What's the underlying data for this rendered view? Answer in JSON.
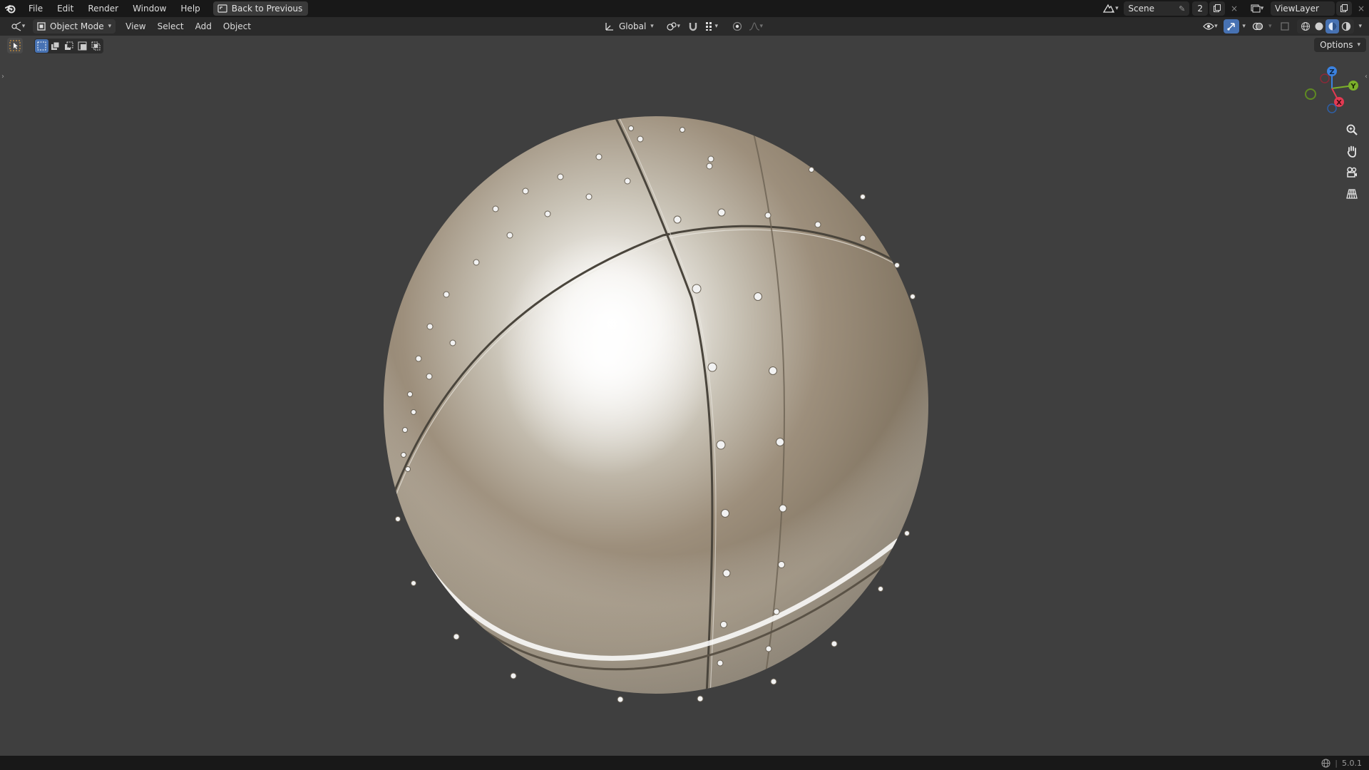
{
  "topbar": {
    "menu": [
      "File",
      "Edit",
      "Render",
      "Window",
      "Help"
    ],
    "back_button": "Back to Previous",
    "scene_name": "Scene",
    "scene_users": "2",
    "view_layer": "ViewLayer"
  },
  "viewport_header": {
    "mode": "Object Mode",
    "menus": [
      "View",
      "Select",
      "Add",
      "Object"
    ],
    "transform_orientation": "Global",
    "options_label": "Options"
  },
  "gizmo": {
    "axes": [
      "Z",
      "Y",
      "X"
    ],
    "colors": {
      "x": "#e23a52",
      "y": "#7bb02a",
      "z": "#3b82e0"
    }
  },
  "statusbar": {
    "version": "5.0.1"
  },
  "colors": {
    "topbar_bg": "#181818",
    "header_bg": "#2a2a2a",
    "viewport_bg": "#3f3f3f",
    "accent": "#4772b3"
  }
}
